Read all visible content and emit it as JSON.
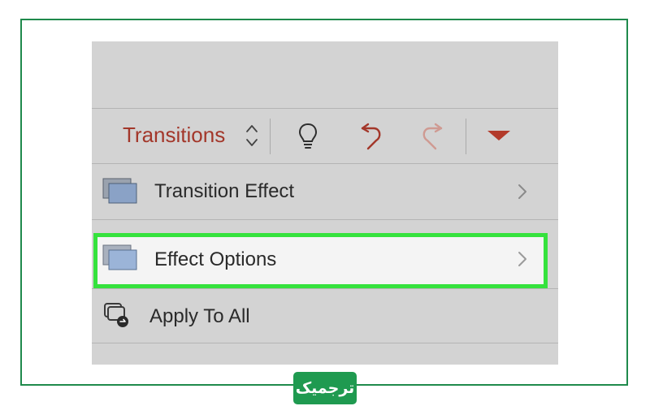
{
  "toolbar": {
    "title": "Transitions",
    "buttons": {
      "updown": "chevron-up-down-icon",
      "tip": "lightbulb-icon",
      "undo": "undo-icon",
      "redo": "redo-icon",
      "menu": "triangle-down-icon"
    }
  },
  "menu": {
    "items": [
      {
        "label": "Transition Effect",
        "icon": "slides-stack-icon",
        "has_chevron": true
      },
      {
        "label": "Effect Options",
        "icon": "slides-stack-icon",
        "has_chevron": true,
        "highlighted": true
      },
      {
        "label": "Apply To All",
        "icon": "apply-all-icon",
        "has_chevron": false
      }
    ]
  },
  "watermark": {
    "text": "ترجمیک"
  },
  "colors": {
    "accent": "#a3372a",
    "highlight_border": "#35e23d",
    "frame": "#1f8a4c",
    "badge": "#1f9a50"
  }
}
